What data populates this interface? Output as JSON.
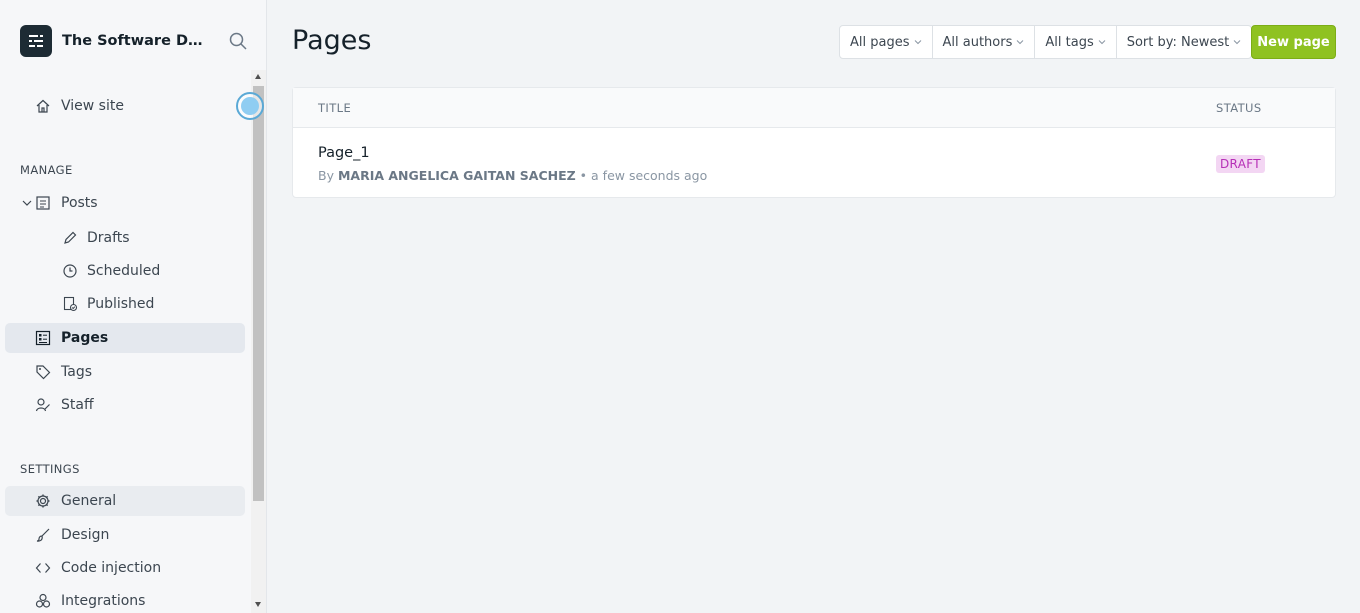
{
  "app": {
    "site_name": "The Software Design Hub",
    "logo_icon": "ghost-logo-icon",
    "search_icon": "search-icon"
  },
  "sidebar": {
    "view_site": "View site",
    "manage_heading": "MANAGE",
    "posts": "Posts",
    "drafts": "Drafts",
    "scheduled": "Scheduled",
    "published": "Published",
    "pages": "Pages",
    "tags": "Tags",
    "staff": "Staff",
    "settings_heading": "SETTINGS",
    "general": "General",
    "design": "Design",
    "code_injection": "Code injection",
    "integrations": "Integrations"
  },
  "main": {
    "title": "Pages",
    "filters": {
      "type": "All pages",
      "author": "All authors",
      "tag": "All tags",
      "sort": "Sort by: Newest"
    },
    "new_button": "New page",
    "table": {
      "col_title": "TITLE",
      "col_status": "STATUS",
      "rows": [
        {
          "title": "Page_1",
          "by_prefix": "By",
          "author": "MARIA ANGELICA GAITAN SACHEZ",
          "separator": "•",
          "time": "a few seconds ago",
          "status": "DRAFT"
        }
      ]
    }
  },
  "colors": {
    "accent_green": "#8fc221",
    "draft_badge_bg": "#f3d6f3",
    "draft_badge_text": "#b62fb6",
    "sidebar_active": "#e4e8ee"
  }
}
